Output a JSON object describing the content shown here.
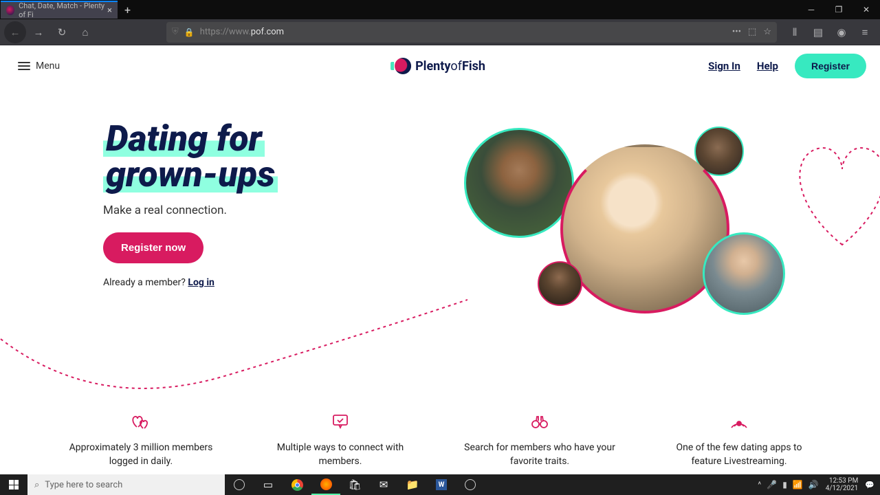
{
  "browser": {
    "tab_title": "Chat, Date, Match - Plenty of Fi",
    "url_prefix": "https://www.",
    "url_domain": "pof.com"
  },
  "header": {
    "menu": "Menu",
    "logo_bold": "Plenty",
    "logo_mid": "of",
    "logo_end": "Fish",
    "signin": "Sign In",
    "help": "Help",
    "register": "Register"
  },
  "hero": {
    "title_line1": "Dating for",
    "title_line2": "grown-ups",
    "subtitle": "Make a real connection.",
    "cta": "Register now",
    "member_prompt": "Already a member? ",
    "login": "Log in"
  },
  "features": [
    {
      "text": "Approximately 3 million members logged in daily."
    },
    {
      "text": "Multiple ways to connect with members."
    },
    {
      "text": "Search for members who have your favorite traits."
    },
    {
      "text": "One of the few dating apps to feature Livestreaming."
    }
  ],
  "taskbar": {
    "search_placeholder": "Type here to search",
    "time": "12:53 PM",
    "date": "4/12/2021"
  }
}
